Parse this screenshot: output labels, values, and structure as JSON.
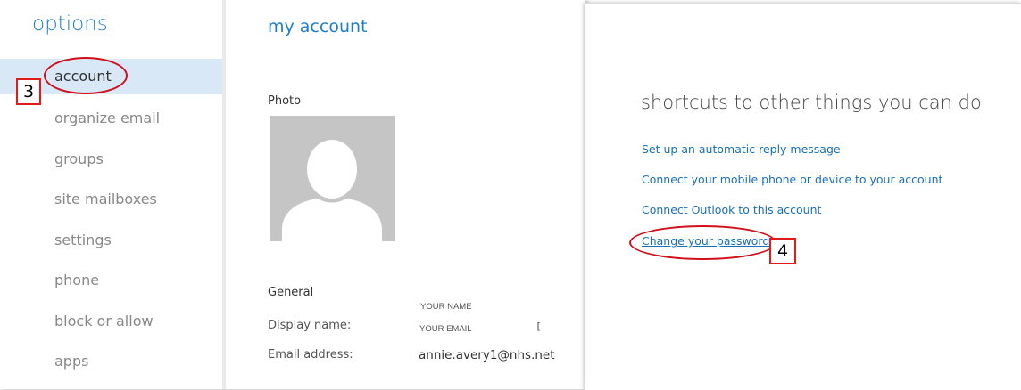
{
  "sidebar": {
    "title": "options",
    "items": [
      {
        "label": "account"
      },
      {
        "label": "organize email"
      },
      {
        "label": "groups"
      },
      {
        "label": "site mailboxes"
      },
      {
        "label": "settings"
      },
      {
        "label": "phone"
      },
      {
        "label": "block or allow"
      },
      {
        "label": "apps"
      }
    ]
  },
  "main": {
    "title": "my account",
    "photo_label": "Photo",
    "general_label": "General",
    "display_name_label": "Display name:",
    "email_address_label": "Email address:",
    "name_placeholder": "YOUR NAME",
    "email_placeholder": "YOUR EMAIL",
    "cursor_char": "[",
    "email_value": "annie.avery1@nhs.net"
  },
  "shortcuts": {
    "title": "shortcuts to other things you can do",
    "links": [
      {
        "label": "Set up an automatic reply message"
      },
      {
        "label": "Connect your mobile phone or device to your account"
      },
      {
        "label": "Connect Outlook to this account"
      },
      {
        "label": "Change your password"
      }
    ]
  },
  "annotations": {
    "step3": "3",
    "step4": "4"
  },
  "colors": {
    "accent": "#1e7fc4",
    "link": "#1a6fb8",
    "active_bg": "#d9e8f7",
    "annotation_red": "#d0101a"
  }
}
